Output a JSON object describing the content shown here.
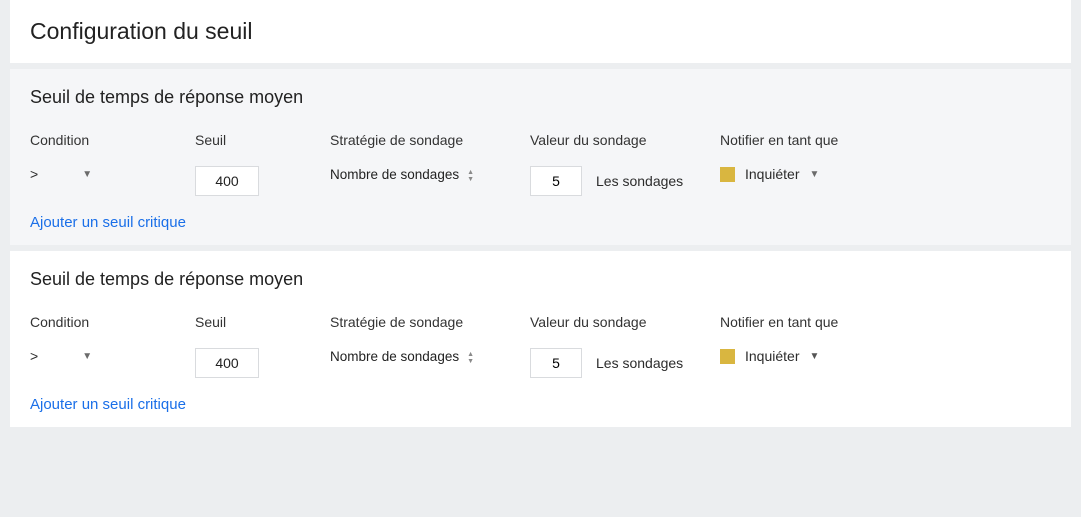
{
  "panel": {
    "title": "Configuration du seuil"
  },
  "headers": {
    "condition": "Condition",
    "threshold": "Seuil",
    "strategy": "Stratégie de sondage",
    "poll_value": "Valeur du sondage",
    "notify_as": "Notifier en tant que"
  },
  "sections": {
    "s1": {
      "title": "Seuil de temps de réponse moyen",
      "condition": ">",
      "threshold": "400",
      "strategy": "Nombre de sondages",
      "poll_value": "5",
      "poll_label": "Les sondages",
      "notify_label": "Inquiéter",
      "notify_color": "#d9b640",
      "add_link": "Ajouter un seuil critique"
    },
    "s2": {
      "title": "Seuil de temps de réponse moyen",
      "condition": ">",
      "threshold": "400",
      "strategy": "Nombre de sondages",
      "poll_value": "5",
      "poll_label": "Les sondages",
      "notify_label": "Inquiéter",
      "notify_color": "#d9b640",
      "add_link": "Ajouter un seuil critique"
    }
  }
}
